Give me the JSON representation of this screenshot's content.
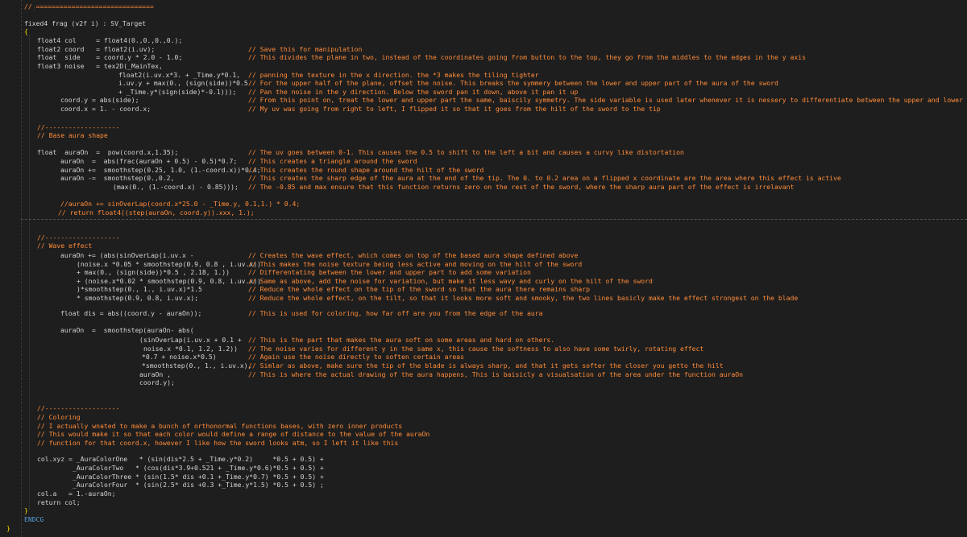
{
  "code": {
    "header_rule": "// ==============================",
    "frag_decl": "fixed4 frag (v2f i) : SV_Target",
    "open_brace": "{",
    "close_brace": "}",
    "endcg": "ENDCG",
    "final_brace": "}",
    "l_col": "float4 col     = float4(0.,0.,0.,0.);",
    "l_coord": "float2 coord   = float2(i.uv);",
    "l_side": "float  side    = coord.y * 2.0 - 1.0;",
    "l_noise": "float3 noise   = tex2D(_MainTex,",
    "l_noise2": "float2(i.uv.x*3. + _Time.y*0.1,",
    "l_noise3": "i.uv.y + max(0., (sign(side))*0.5",
    "l_noise4": "+ _Time.y*(sign(side)*-0.1)));",
    "l_cy": "coord.y = abs(side);",
    "l_cx": "coord.x = 1. - coord.x;",
    "c_save": "// Save this for manipulation",
    "c_divides": "// This divides the plane in two, instead of the coordinates going from button to the top, they go from the middles to the edges in the y axis",
    "c_panning": "// panning the texture in the x direction. the *3 makes the tiling tighter",
    "c_upper": "// For the upper half of the plane, offset the noise. This breaks the symmery between the lower and upper part of the aura of the sword",
    "c_pan": "// Pan the noise in the y direction. Below the sword pan it down, above it pan it up",
    "c_from": "// From this point on, treat the lower and upper part the same, baiscily symmetry. The side variable is used later whenever it is nessery to differentiate between the upper and lower half",
    "c_myuv": "// My uv was going from right to left, I flipped it so that it goes from the hilt of the sword to the tip",
    "base_rule": "//-------------------",
    "base_title": "// Base aura shape",
    "b1": "float  auraOn  =  pow(coord.x,1.35);",
    "b2": "auraOn  =  abs(frac(auraOn + 0.5) - 0.5)*0.7;",
    "b3": "auraOn +=  smoothstep(0.25, 1.0, (1.-coord.x))*0.4;",
    "b4": "auraOn -=  smoothstep(0.,0.2,",
    "b5": "(max(0., (1.-coord.x) - 0.85)));",
    "cb1": "// The uv goes between 0-1. This causes the 0.5 to shift to the left a bit and causes a curvy like distortation",
    "cb2": "// This creates a triangle around the sword",
    "cb3": "// This creates the round shape around the hilt of the sword",
    "cb4": "// This creates the sharp edge of the aura at the end of the tip. The 0. to 0.2 area on a flipped x coordinate are the area where this effect is active",
    "cb5": "// The -0.85 and max ensure that this function returns zero on the rest of the sword, where the sharp aura part of the effect is irrelavant",
    "b6": "//auraOn += sinOverLap(coord.x*25.0 - _Time.y, 0.1,1.) * 0.4;",
    "b7": "// return float4((step(auraOn, coord.y)).xxx, 1.);",
    "wave_rule": "//-------------------",
    "wave_title": "// Wave effect",
    "w1": "auraOn += (abs(sinOverLap(i.uv.x -",
    "w2": "(noise.x *0.05 * smoothstep(0.9, 0.8 , i.uv.x))",
    "w3": "+ max(0., (sign(side))*0.5 , 2.18, 1.))",
    "w4": "+ (noise.x*0.02 * smoothstep(0.9, 0.8, i.uv.x))",
    "w5": ")*smoothstep(0., 1., i.uv.x)*1.5",
    "w6": "* smoothstep(0.9, 0.8, i.uv.x);",
    "cw1": "// Creates the wave effect, which comes on top of the based aura shape defined above",
    "cw2": "// This makes the noise texture being less active and moving on the hilt of the sword",
    "cw3": "// Differentating between the lower and upper part to add some variation",
    "cw4": "// Same as above, add the noise for variation, but make it less wavy and curly on the hilt of the sword",
    "cw5": "// Reduce the whole effect on the tip of the sword so that the aura there remains sharp",
    "cw6": "// Reduce the whole effect, on the tilt, so that it looks more soft and smooky, the two lines basicly make the effect strongest on the blade",
    "dis": "float dis = abs((coord.y - auraOn));",
    "c_dis": "// This is used for coloring, how far off are you from the edge of the aura",
    "s1": "auraOn  =  smoothstep(auraOn- abs(",
    "s2": "(sinOverLap(i.uv.x + 0.1 +",
    "s3": "noise.x *0.1, 1.2, 1.2))",
    "s4": "*0.7 + noise.x*0.5)",
    "s5": "*smoothstep(0., 1., i.uv.x),",
    "s6": "auraOn ,",
    "s7": "coord.y);",
    "cs1": "// This is the part that makes the aura soft on some areas and hard on others.",
    "cs2": "// The noise varies for different y in the same x, this cause the softness to also have some twirly, rotating effect",
    "cs3": "// Again use the noise directly to soften certain areas",
    "cs4": "// Simlar as above, make sure the tip of the blade is always sharp, and that it gets softer the closer you getto the hilt",
    "cs5": "// This is where the actual drawing of the aura happens, This is baisicly a visualsation of the area under the function auraOn",
    "col_rule": "//-------------------",
    "col_title": "// Coloring",
    "col_c1": "// I actually wnated to make a bunch of orthonormal functions bases, with zero inner products",
    "col_c2": "// This would make it so that each color would define a range of distance to the value of the auraOn",
    "col_c3": "// function for that coord.x, however I like how the sword looks atm, so I left it like this",
    "k1": "col.xyz = _AuraColorOne   * (sin(dis*2.5 + _Time.y*0.2)     *0.5 + 0.5) +",
    "k2": "_AuraColorTwo   * (cos(dis*3.9+0.521 + _Time.y*0.6)*0.5 + 0.5) +",
    "k3": "_AuraColorThree * (sin(1.5* dis +0.1 +_Time.y*0.7) *0.5 + 0.5) +",
    "k4": "_AuraColorFour  * (sin(2.5* dis +0.3 +_Time.y*1.5) *0.5 + 0.5) ;",
    "k5": "col.a   = 1.-auraOn;",
    "k6": "return col;"
  }
}
